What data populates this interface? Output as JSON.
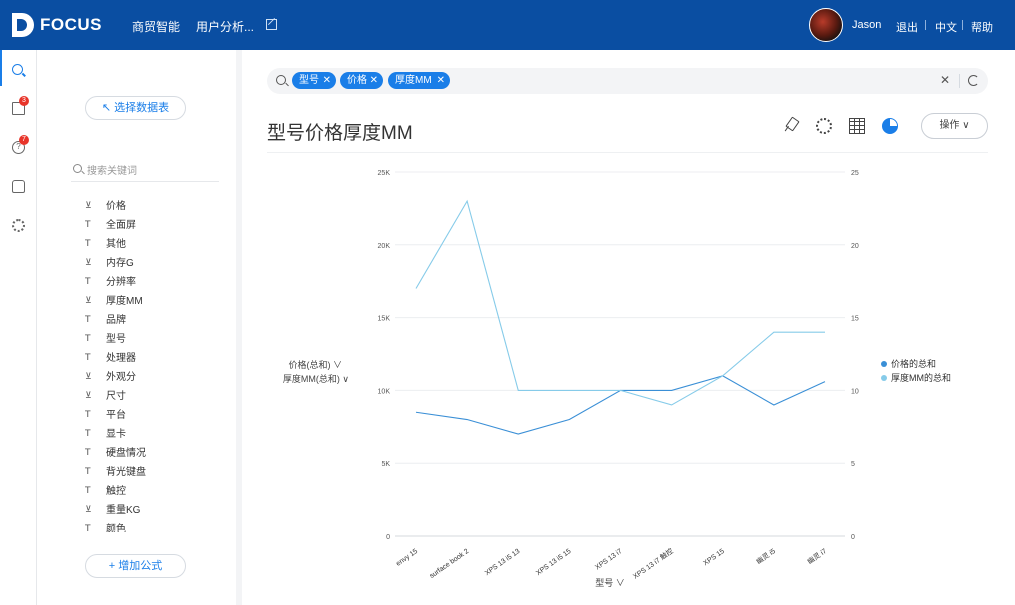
{
  "app": {
    "brand": "FOCUS"
  },
  "topbar": {
    "nav": [
      "商贸智能",
      "用户分析..."
    ],
    "user": "Jason",
    "logout": "退出",
    "lang": "中文",
    "help": "帮助"
  },
  "rail": {
    "board_badge": "3",
    "help_badge": "7"
  },
  "fieldpanel": {
    "select_table": "↖ 选择数据表",
    "search_placeholder": "搜索关键词",
    "add_formula": "+ 增加公式",
    "fields": [
      {
        "type": "measure",
        "label": "价格"
      },
      {
        "type": "attribute",
        "label": "全面屏"
      },
      {
        "type": "attribute",
        "label": "其他"
      },
      {
        "type": "measure",
        "label": "内存G"
      },
      {
        "type": "attribute",
        "label": "分辨率"
      },
      {
        "type": "measure",
        "label": "厚度MM"
      },
      {
        "type": "attribute",
        "label": "品牌"
      },
      {
        "type": "attribute",
        "label": "型号"
      },
      {
        "type": "attribute",
        "label": "处理器"
      },
      {
        "type": "measure",
        "label": "外观分"
      },
      {
        "type": "measure",
        "label": "尺寸"
      },
      {
        "type": "attribute",
        "label": "平台"
      },
      {
        "type": "attribute",
        "label": "显卡"
      },
      {
        "type": "attribute",
        "label": "硬盘情况"
      },
      {
        "type": "attribute",
        "label": "背光键盘"
      },
      {
        "type": "attribute",
        "label": "触控"
      },
      {
        "type": "measure",
        "label": "重量KG"
      },
      {
        "type": "attribute",
        "label": "颜色"
      }
    ]
  },
  "search": {
    "tags": [
      "型号",
      "价格",
      "厚度MM"
    ]
  },
  "main": {
    "title": "型号价格厚度MM",
    "op_button": "操作 ∨"
  },
  "colors": {
    "price": "#3a8fd6",
    "thickness": "#86cbe9",
    "accent": "#1a7ee8",
    "topbar": "#0a4ea2"
  },
  "chart_data": {
    "type": "line",
    "categories": [
      "envy 15",
      "surface book 2",
      "XPS 13 i5 13",
      "XPS 13 i5 15",
      "XPS 13 i7",
      "XPS 13 i7 触控",
      "XPS 15",
      "幽灵 i5",
      "幽灵 i7"
    ],
    "series": [
      {
        "name": "价格的总和",
        "axis": "left",
        "values": [
          8500,
          8000,
          7000,
          8000,
          10000,
          10000,
          11000,
          9000,
          10600
        ]
      },
      {
        "name": "厚度MM的总和",
        "axis": "right",
        "values": [
          17,
          23,
          10,
          10,
          10,
          9,
          11,
          14,
          14
        ]
      }
    ],
    "y_left": {
      "ylim": [
        0,
        25000
      ],
      "ticks": [
        "0",
        "5K",
        "10K",
        "15K",
        "20K",
        "25K"
      ],
      "labels": [
        "价格(总和) ∨",
        "厚度MM(总和) ∨"
      ]
    },
    "y_right": {
      "ylim": [
        0,
        25
      ],
      "ticks": [
        "0",
        "5",
        "10",
        "15",
        "20",
        "25"
      ]
    },
    "xlabel": "型号 ∨",
    "grid": true,
    "legend": "right"
  }
}
